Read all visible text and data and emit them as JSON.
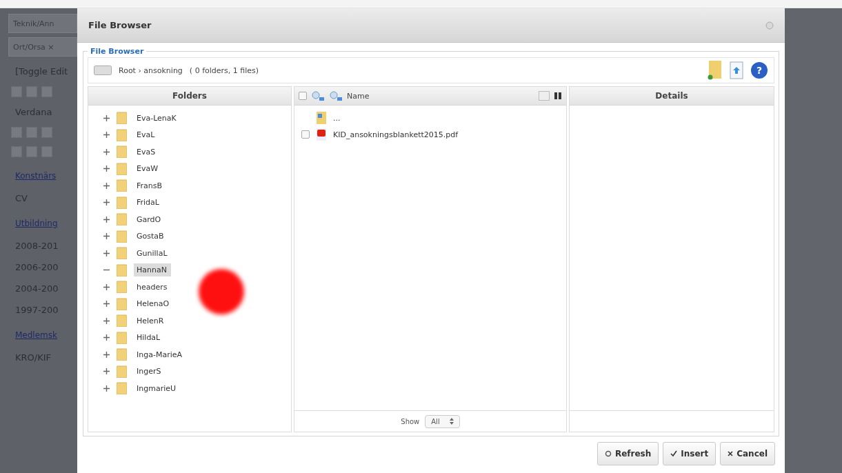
{
  "background_page": {
    "items": [
      {
        "kind": "field",
        "text": "Teknik/Ann"
      },
      {
        "kind": "field",
        "text": "Ort/Orsa ×"
      },
      {
        "kind": "text",
        "text": "[Toggle Edit"
      },
      {
        "kind": "toolbar"
      },
      {
        "kind": "text",
        "text": "Verdana"
      },
      {
        "kind": "toolbar"
      },
      {
        "kind": "toolbar"
      },
      {
        "kind": "link",
        "text": "Konstnärs"
      },
      {
        "kind": "text",
        "text": "CV"
      },
      {
        "kind": "link",
        "text": "Utbildning"
      },
      {
        "kind": "text",
        "text": "2008-201"
      },
      {
        "kind": "text",
        "text": "2006-200"
      },
      {
        "kind": "text",
        "text": "2004-200"
      },
      {
        "kind": "text",
        "text": "1997-200"
      },
      {
        "kind": "link",
        "text": "Medlemsk"
      },
      {
        "kind": "text",
        "text": "KRO/KIF"
      }
    ]
  },
  "dialog": {
    "title": "File Browser",
    "legend": "File Browser",
    "path": {
      "crumbs": "Root › ansokning",
      "summary": "( 0 folders, 1 files)",
      "help_glyph": "?"
    },
    "select_all_checked": false,
    "folders_header": "Folders",
    "folders": [
      {
        "name": "Eva-LenaK",
        "expanded": false,
        "selected": false
      },
      {
        "name": "EvaL",
        "expanded": false,
        "selected": false
      },
      {
        "name": "EvaS",
        "expanded": false,
        "selected": false
      },
      {
        "name": "EvaW",
        "expanded": false,
        "selected": false
      },
      {
        "name": "FransB",
        "expanded": false,
        "selected": false
      },
      {
        "name": "FridaL",
        "expanded": false,
        "selected": false
      },
      {
        "name": "GardO",
        "expanded": false,
        "selected": false
      },
      {
        "name": "GostaB",
        "expanded": false,
        "selected": false
      },
      {
        "name": "GunillaL",
        "expanded": false,
        "selected": false
      },
      {
        "name": "HannaN",
        "expanded": true,
        "selected": true
      },
      {
        "name": "headers",
        "expanded": false,
        "selected": false
      },
      {
        "name": "HelenaO",
        "expanded": false,
        "selected": false
      },
      {
        "name": "HelenR",
        "expanded": false,
        "selected": false
      },
      {
        "name": "HildaL",
        "expanded": false,
        "selected": false
      },
      {
        "name": "Inga-MarieA",
        "expanded": false,
        "selected": false
      },
      {
        "name": "IngerS",
        "expanded": false,
        "selected": false
      },
      {
        "name": "IngmarieU",
        "expanded": false,
        "selected": false
      }
    ],
    "files_header": "Name",
    "files": [
      {
        "kind": "parent",
        "name": "..."
      },
      {
        "kind": "pdf",
        "name": "KID_ansokningsblankett2015.pdf",
        "checked": false
      }
    ],
    "details_header": "Details",
    "show_label": "Show",
    "show_value": "All",
    "buttons": [
      {
        "kind": "refresh",
        "label": "Refresh"
      },
      {
        "kind": "insert",
        "label": "Insert"
      },
      {
        "kind": "cancel",
        "label": "Cancel"
      }
    ]
  }
}
